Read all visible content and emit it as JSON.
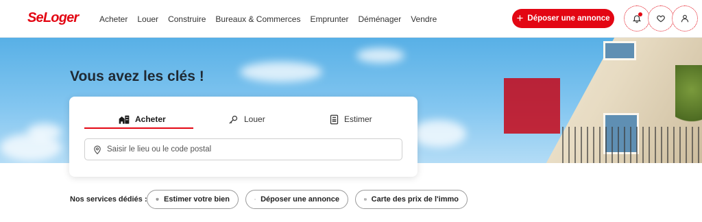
{
  "header": {
    "logo": "SeLoger",
    "nav": [
      "Acheter",
      "Louer",
      "Construire",
      "Bureaux & Commerces",
      "Emprunter",
      "Déménager",
      "Vendre"
    ],
    "cta_label": "Déposer une annonce",
    "brand_color": "#e30613"
  },
  "hero": {
    "title": "Vous avez les clés !"
  },
  "search": {
    "tabs": [
      {
        "label": "Acheter",
        "icon": "buildings-icon",
        "active": true
      },
      {
        "label": "Louer",
        "icon": "key-icon",
        "active": false
      },
      {
        "label": "Estimer",
        "icon": "calculator-icon",
        "active": false
      }
    ],
    "placeholder": "Saisir le lieu ou le code postal"
  },
  "services": {
    "label": "Nos services dédiés :",
    "items": [
      {
        "label": "Estimer votre bien",
        "icon": "coins-icon"
      },
      {
        "label": "Déposer une annonce",
        "icon": "plus-icon"
      },
      {
        "label": "Carte des prix de l'immo",
        "icon": "map-icon"
      }
    ]
  }
}
